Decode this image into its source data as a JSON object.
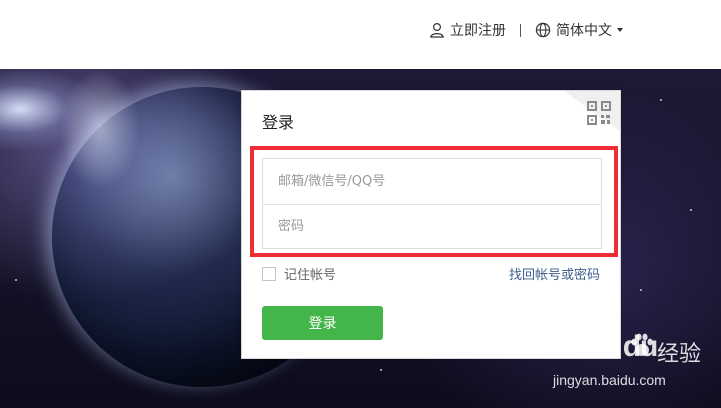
{
  "header": {
    "register_label": "立即注册",
    "language_label": "简体中文",
    "user_icon": "user-icon",
    "globe_icon": "globe-icon",
    "caret_icon": "caret-down-icon"
  },
  "login": {
    "title": "登录",
    "qr_icon": "qr-code-icon",
    "account_placeholder": "邮箱/微信号/QQ号",
    "password_placeholder": "密码",
    "remember_label": "记住帐号",
    "forgot_label": "找回帐号或密码",
    "submit_label": "登录"
  },
  "watermark": {
    "brand": "Bai",
    "brand_suffix": "du",
    "section": "经验",
    "url": "jingyan.baidu.com"
  },
  "colors": {
    "accent_green": "#44b549",
    "highlight_red": "#ee2d34",
    "link_blue": "#3d5f8e"
  }
}
